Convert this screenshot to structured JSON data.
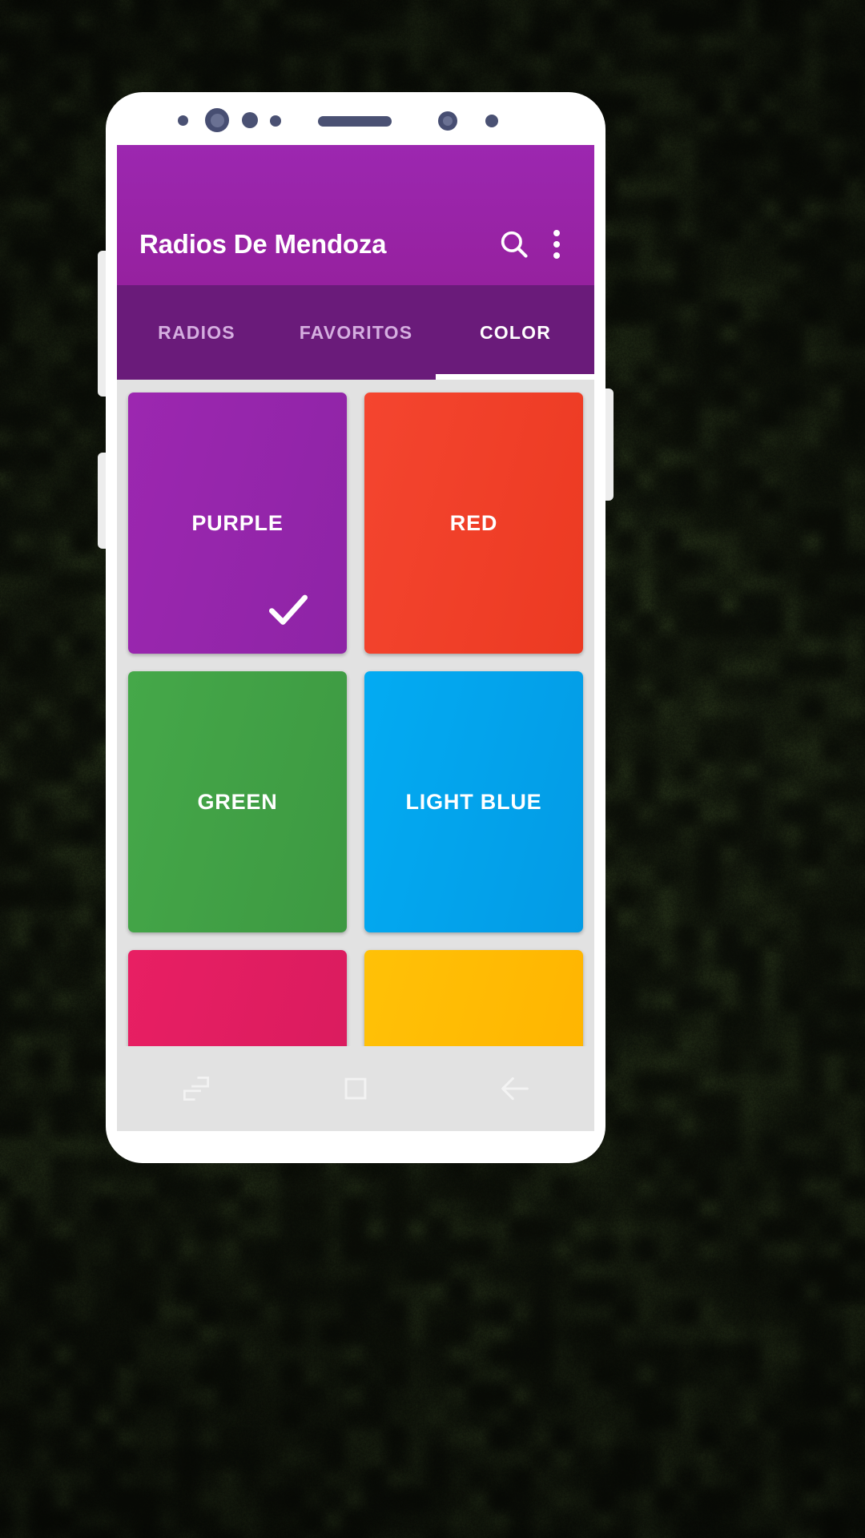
{
  "background": {
    "base_color": "#0d0f08",
    "noise_color": "#1d2212"
  },
  "device": {
    "frame_color": "#ffffff",
    "sensor_color": "#4a5173",
    "sensors": [
      {
        "name": "sensor-dot-small-1"
      },
      {
        "name": "front-camera"
      },
      {
        "name": "sensor-dot-medium"
      },
      {
        "name": "sensor-dot-small-2"
      },
      {
        "name": "earpiece-speaker"
      },
      {
        "name": "proximity-sensor"
      },
      {
        "name": "sensor-dot-small-3"
      }
    ],
    "side_buttons": [
      "volume-up",
      "volume-down",
      "power"
    ]
  },
  "appbar": {
    "title": "Radios De Mendoza",
    "background_color": "#9c27b0",
    "text_color": "#ffffff",
    "search_icon": "search-icon",
    "overflow_icon": "more-vert-icon"
  },
  "tabs": {
    "background_color": "#6a1b7a",
    "active_index": 2,
    "indicator_color": "#ffffff",
    "inactive_text_color": "#d5aee0",
    "items": [
      {
        "label": "RADIOS"
      },
      {
        "label": "FAVORITOS"
      },
      {
        "label": "COLOR"
      }
    ]
  },
  "content": {
    "background_color": "#e2e2e2",
    "selected_color": "PURPLE",
    "cards": [
      {
        "label": "PURPLE",
        "hex": "#9c27b0",
        "gradient_from": "#9c27b0",
        "gradient_to": "#8e24a6",
        "selected": true,
        "check_icon": "check-icon"
      },
      {
        "label": "RED",
        "hex": "#f4442e",
        "gradient_from": "#f4452f",
        "gradient_to": "#ec3a22",
        "selected": false
      },
      {
        "label": "GREEN",
        "hex": "#43a047",
        "gradient_from": "#45a849",
        "gradient_to": "#3d9942",
        "selected": false
      },
      {
        "label": "LIGHT BLUE",
        "hex": "#03a9f4",
        "gradient_from": "#03abf2",
        "gradient_to": "#039be5",
        "selected": false
      },
      {
        "label": "",
        "hex": "#e91e63",
        "gradient_from": "#e81f63",
        "gradient_to": "#d81b5e",
        "selected": false
      },
      {
        "label": "",
        "hex": "#ffc107",
        "gradient_from": "#ffc107",
        "gradient_to": "#ffb300",
        "selected": false
      }
    ]
  },
  "navbar": {
    "background_color": "#e2e2e2",
    "icon_color": "#f5f5f5",
    "buttons": [
      {
        "name": "recents-button",
        "icon": "recents-icon"
      },
      {
        "name": "home-button",
        "icon": "home-square-icon"
      },
      {
        "name": "back-button",
        "icon": "back-arrow-icon"
      }
    ]
  }
}
